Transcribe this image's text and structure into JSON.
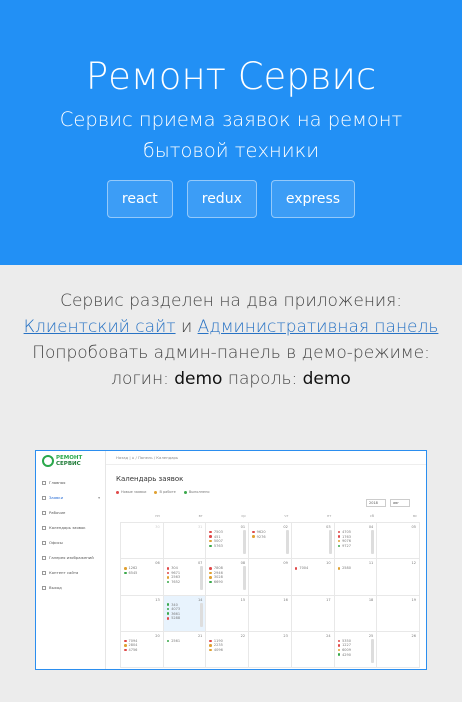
{
  "hero": {
    "title": "Ремонт Сервис",
    "subtitle": "Сервис приема заявок на ремонт бытовой техники",
    "tags": [
      "react",
      "redux",
      "express"
    ],
    "bg_color": "#2290f5"
  },
  "info": {
    "line1": "Сервис разделен на два приложения:",
    "client_link": "Клиентский сайт",
    "and": "и",
    "admin_link": "Административная панель",
    "demo_prompt": "Попробовать админ-панель в демо-режиме:",
    "login_label": "логин:",
    "login_value": "demo",
    "password_label": "пароль:",
    "password_value": "demo"
  },
  "screenshot": {
    "logo_line1": "РЕМОНТ",
    "logo_line2": "СЕРВИС",
    "topbar": "Назад  |  ⌂ / Панель / Календарь",
    "menu": [
      "Главная",
      "Заявки",
      "Рабочие",
      "Календарь заявок",
      "Офисы",
      "Галерея изображений",
      "Контент сайта",
      "Выход"
    ],
    "menu_active": "Заявки",
    "calendar_title": "Календарь заявок",
    "legend": [
      {
        "label": "Новые заявки",
        "color": "#e04848"
      },
      {
        "label": "В работе",
        "color": "#e0a030"
      },
      {
        "label": "Выполнено",
        "color": "#3aa84b"
      }
    ],
    "year": "2018",
    "month": "авг",
    "weekdays": [
      "пн",
      "вт",
      "ср",
      "чт",
      "пт",
      "сб",
      "вс"
    ],
    "weeks": [
      [
        {
          "n": "30",
          "dim": true,
          "orders": []
        },
        {
          "n": "31",
          "dim": true,
          "orders": []
        },
        {
          "n": "01",
          "orders": [
            [
              "#e04848",
              "7503"
            ],
            [
              "#e04848",
              "451"
            ],
            [
              "#e0a030",
              "5007"
            ],
            [
              "#3aa84b",
              "5763"
            ]
          ],
          "scroll": true
        },
        {
          "n": "02",
          "orders": [
            [
              "#e04848",
              "9620"
            ],
            [
              "#e0a030",
              "9276"
            ]
          ],
          "scroll": true
        },
        {
          "n": "03",
          "orders": [],
          "scroll": true
        },
        {
          "n": "04",
          "orders": [
            [
              "#e04848",
              "4705"
            ],
            [
              "#e04848",
              "1763"
            ],
            [
              "#e0a030",
              "9076"
            ],
            [
              "#3aa84b",
              "9727"
            ]
          ],
          "scroll": true
        },
        {
          "n": "05",
          "orders": []
        }
      ],
      [
        {
          "n": "06",
          "orders": [
            [
              "#e0a030",
              "1262"
            ],
            [
              "#3aa84b",
              "6545"
            ]
          ]
        },
        {
          "n": "07",
          "orders": [
            [
              "#e04848",
              "304"
            ],
            [
              "#e04848",
              "9671"
            ],
            [
              "#e0a030",
              "2563"
            ],
            [
              "#3aa84b",
              "7652"
            ]
          ],
          "scroll": true
        },
        {
          "n": "08",
          "orders": [
            [
              "#e04848",
              "7808"
            ],
            [
              "#e0a030",
              "2946"
            ],
            [
              "#e0a030",
              "3028"
            ],
            [
              "#3aa84b",
              "6690"
            ]
          ],
          "scroll": true
        },
        {
          "n": "09",
          "orders": []
        },
        {
          "n": "10",
          "orders": [
            [
              "#e04848",
              "7004"
            ]
          ]
        },
        {
          "n": "11",
          "orders": [
            [
              "#e0a030",
              "2580"
            ]
          ]
        },
        {
          "n": "12",
          "orders": []
        }
      ],
      [
        {
          "n": "13",
          "orders": []
        },
        {
          "n": "14",
          "today": true,
          "orders": [
            [
              "#3aa84b",
              "340"
            ],
            [
              "#3aa84b",
              "4073"
            ],
            [
              "#3aa84b",
              "3661"
            ],
            [
              "#e04848",
              "5288"
            ]
          ],
          "scroll": true
        },
        {
          "n": "15",
          "orders": []
        },
        {
          "n": "16",
          "orders": []
        },
        {
          "n": "17",
          "orders": []
        },
        {
          "n": "18",
          "orders": []
        },
        {
          "n": "19",
          "orders": []
        }
      ],
      [
        {
          "n": "20",
          "orders": [
            [
              "#e04848",
              "7094"
            ],
            [
              "#e0a030",
              "2804"
            ],
            [
              "#e04848",
              "4756"
            ]
          ]
        },
        {
          "n": "21",
          "orders": [
            [
              "#3aa84b",
              "2561"
            ]
          ]
        },
        {
          "n": "22",
          "orders": [
            [
              "#e04848",
              "1190"
            ],
            [
              "#e0a030",
              "2235"
            ],
            [
              "#e0a030",
              "4096"
            ]
          ]
        },
        {
          "n": "23",
          "orders": []
        },
        {
          "n": "24",
          "orders": []
        },
        {
          "n": "25",
          "orders": [
            [
              "#e04848",
              "5350"
            ],
            [
              "#e04848",
              "1227"
            ],
            [
              "#e0a030",
              "6009"
            ],
            [
              "#3aa84b",
              "4290"
            ]
          ],
          "scroll": true
        },
        {
          "n": "26",
          "orders": []
        }
      ]
    ]
  }
}
